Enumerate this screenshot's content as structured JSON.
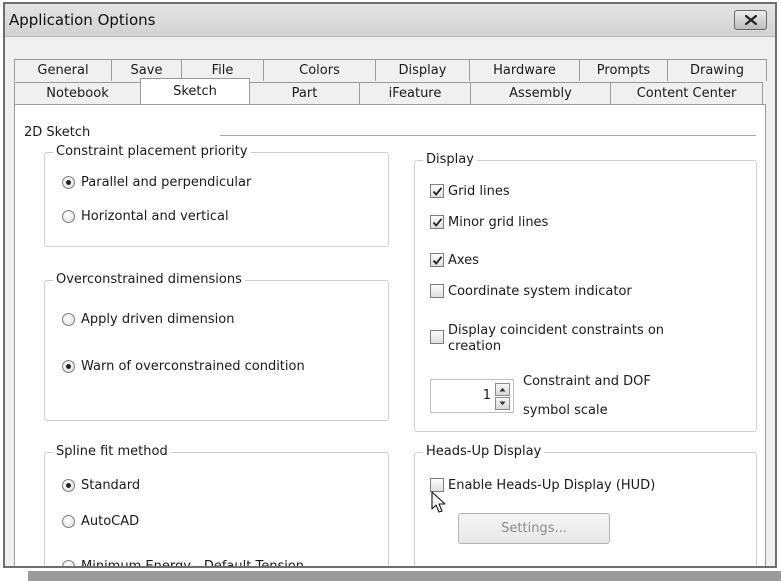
{
  "window": {
    "title": "Application Options"
  },
  "tabs_row1": [
    "General",
    "Save",
    "File",
    "Colors",
    "Display",
    "Hardware",
    "Prompts",
    "Drawing"
  ],
  "tabs_row2": [
    "Notebook",
    "Sketch",
    "Part",
    "iFeature",
    "Assembly",
    "Content Center"
  ],
  "active_tab": "Sketch",
  "section": {
    "label": "2D Sketch"
  },
  "constraint_placement": {
    "legend": "Constraint placement priority",
    "options": [
      {
        "label": "Parallel and perpendicular",
        "selected": true
      },
      {
        "label": "Horizontal and vertical",
        "selected": false
      }
    ]
  },
  "overconstrained": {
    "legend": "Overconstrained dimensions",
    "options": [
      {
        "label": "Apply driven dimension",
        "selected": false
      },
      {
        "label": "Warn of overconstrained condition",
        "selected": true
      }
    ]
  },
  "spline_fit": {
    "legend": "Spline fit method",
    "options": [
      {
        "label": "Standard",
        "selected": true
      },
      {
        "label": "AutoCAD",
        "selected": false
      },
      {
        "label": "Minimum Energy - Default Tension",
        "selected": false
      }
    ]
  },
  "display": {
    "legend": "Display",
    "checkboxes": [
      {
        "label": "Grid lines",
        "checked": true
      },
      {
        "label": "Minor grid lines",
        "checked": true
      },
      {
        "label": "Axes",
        "checked": true
      },
      {
        "label": "Coordinate system indicator",
        "checked": false
      },
      {
        "label": "Display coincident constraints on creation",
        "checked": false
      }
    ],
    "scale_value": "1",
    "scale_label_line1": "Constraint and DOF",
    "scale_label_line2": "symbol scale"
  },
  "hud": {
    "legend": "Heads-Up Display",
    "enable_label": "Enable Heads-Up Display (HUD)",
    "enable_checked": false,
    "settings_label": "Settings..."
  }
}
